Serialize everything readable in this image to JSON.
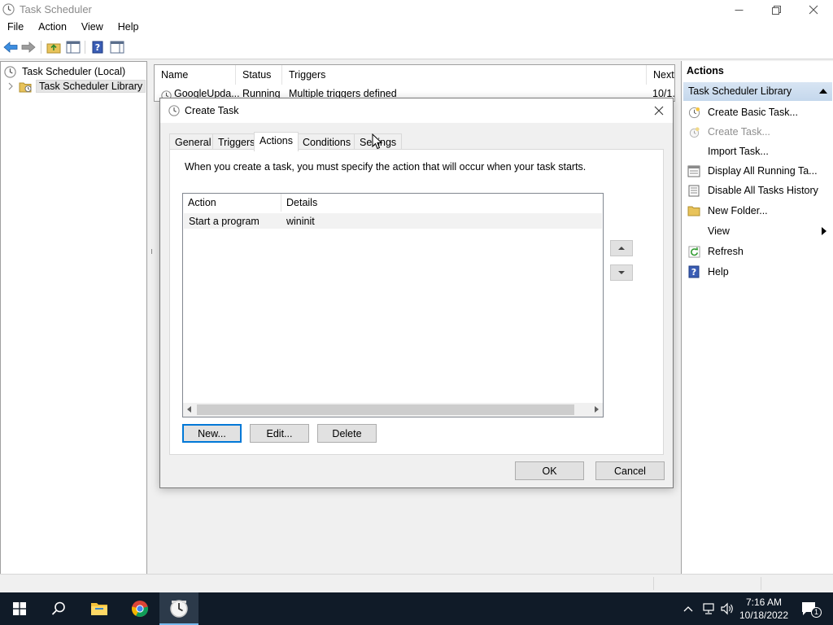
{
  "window": {
    "title": "Task Scheduler",
    "minimize": "—",
    "restore": "❐",
    "close": "✕"
  },
  "menu": [
    "File",
    "Action",
    "View",
    "Help"
  ],
  "tree": {
    "root": "Task Scheduler (Local)",
    "library": "Task Scheduler Library"
  },
  "task_list": {
    "columns": [
      "Name",
      "Status",
      "Triggers",
      "Next"
    ],
    "rows": [
      {
        "name": "GoogleUpda...",
        "status": "Running",
        "triggers": "Multiple triggers defined",
        "next": "10/1..."
      }
    ]
  },
  "actions_pane": {
    "header": "Actions",
    "section": "Task Scheduler Library",
    "items": [
      {
        "label": "Create Basic Task...",
        "icon": "create-basic-task-icon",
        "enabled": true
      },
      {
        "label": "Create Task...",
        "icon": "create-task-icon",
        "enabled": false
      },
      {
        "label": "Import Task...",
        "icon": "",
        "enabled": true
      },
      {
        "label": "Display All Running Ta...",
        "icon": "running-tasks-icon",
        "enabled": true
      },
      {
        "label": "Disable All Tasks History",
        "icon": "tasks-history-icon",
        "enabled": true
      },
      {
        "label": "New Folder...",
        "icon": "folder-icon",
        "enabled": true
      },
      {
        "label": "View",
        "icon": "",
        "enabled": true,
        "submenu": true
      },
      {
        "label": "Refresh",
        "icon": "refresh-icon",
        "enabled": true
      },
      {
        "label": "Help",
        "icon": "help-icon",
        "enabled": true
      }
    ]
  },
  "dialog": {
    "title": "Create Task",
    "close": "✕",
    "tabs": [
      "General",
      "Triggers",
      "Actions",
      "Conditions",
      "Settings"
    ],
    "active_tab": "Actions",
    "description": "When you create a task, you must specify the action that will occur when your task starts.",
    "grid": {
      "columns": [
        "Action",
        "Details"
      ],
      "rows": [
        {
          "action": "Start a program",
          "details": "wininit"
        }
      ]
    },
    "buttons": {
      "new": "New...",
      "edit": "Edit...",
      "delete": "Delete",
      "ok": "OK",
      "cancel": "Cancel"
    }
  },
  "taskbar": {
    "time": "7:16 AM",
    "date": "10/18/2022",
    "notification_count": "1",
    "accent": "#76b9ed"
  }
}
